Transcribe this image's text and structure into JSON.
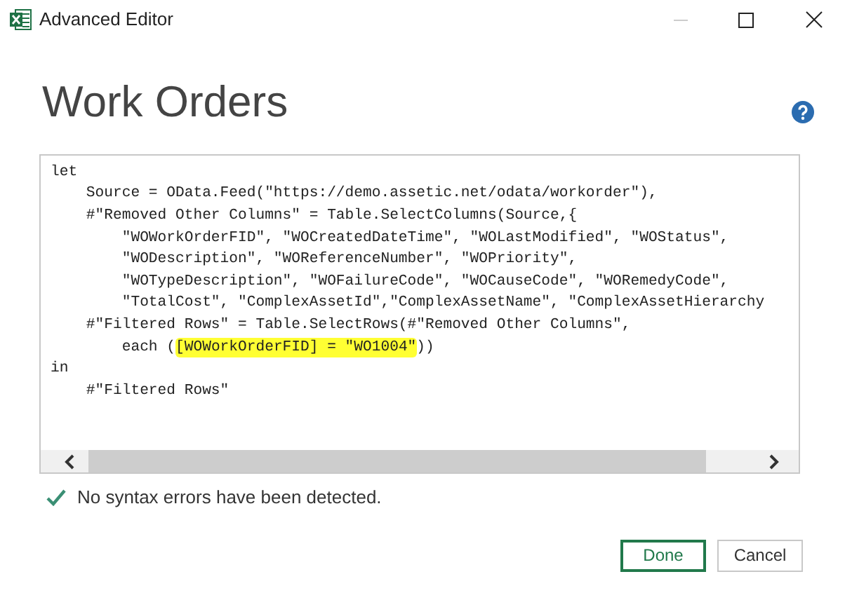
{
  "window": {
    "title": "Advanced Editor"
  },
  "heading": "Work Orders",
  "code_lines": [
    [
      {
        "text": "let",
        "highlighted": false
      }
    ],
    [
      {
        "text": "    Source = OData.Feed(\"https://demo.assetic.net/odata/workorder\"),",
        "highlighted": false
      }
    ],
    [
      {
        "text": "    #\"Removed Other Columns\" = Table.SelectColumns(Source,{",
        "highlighted": false
      }
    ],
    [
      {
        "text": "        \"WOWorkOrderFID\", \"WOCreatedDateTime\", \"WOLastModified\", \"WOStatus\",",
        "highlighted": false
      }
    ],
    [
      {
        "text": "        \"WODescription\", \"WOReferenceNumber\", \"WOPriority\",",
        "highlighted": false
      }
    ],
    [
      {
        "text": "        \"WOTypeDescription\", \"WOFailureCode\", \"WOCauseCode\", \"WORemedyCode\",",
        "highlighted": false
      }
    ],
    [
      {
        "text": "        \"TotalCost\", \"ComplexAssetId\",\"ComplexAssetName\", \"ComplexAssetHierarchy",
        "highlighted": false
      }
    ],
    [
      {
        "text": "    #\"Filtered Rows\" = Table.SelectRows(#\"Removed Other Columns\",",
        "highlighted": false
      }
    ],
    [
      {
        "text": "        each (",
        "highlighted": false
      },
      {
        "text": "[WOWorkOrderFID] = \"WO1004\"",
        "highlighted": true
      },
      {
        "text": "))",
        "highlighted": false
      }
    ],
    [
      {
        "text": "in",
        "highlighted": false
      }
    ],
    [
      {
        "text": "    #\"Filtered Rows\"",
        "highlighted": false
      }
    ]
  ],
  "status": "No syntax errors have been detected.",
  "buttons": [
    {
      "label": "Done",
      "default": true
    },
    {
      "label": "Cancel",
      "default": false
    }
  ]
}
